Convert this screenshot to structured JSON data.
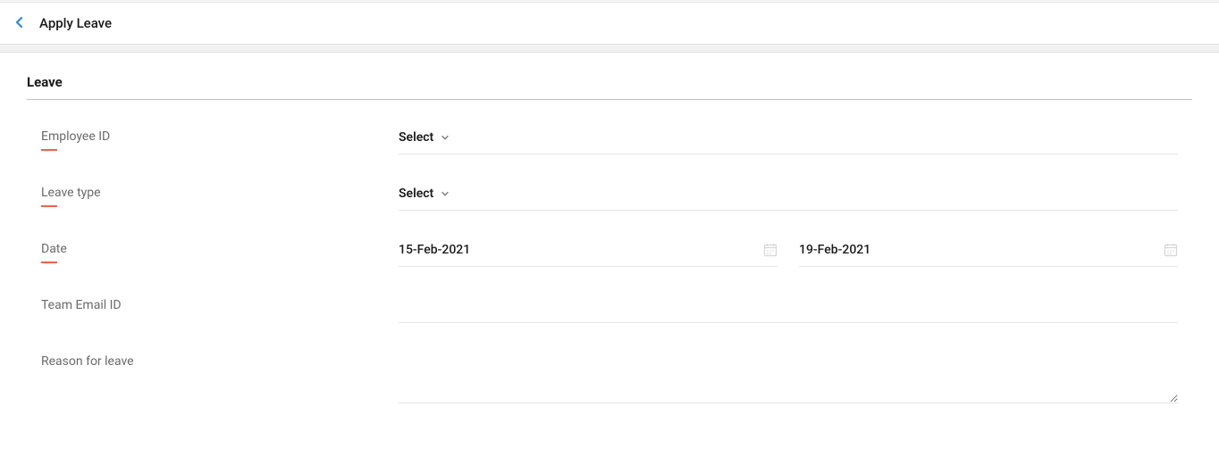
{
  "header": {
    "title": "Apply Leave"
  },
  "section": {
    "title": "Leave"
  },
  "fields": {
    "employee_id": {
      "label": "Employee ID",
      "placeholder": "Select"
    },
    "leave_type": {
      "label": "Leave type",
      "placeholder": "Select"
    },
    "date": {
      "label": "Date",
      "from": "15-Feb-2021",
      "to": "19-Feb-2021"
    },
    "team_email": {
      "label": "Team Email ID",
      "value": ""
    },
    "reason": {
      "label": "Reason for leave",
      "value": ""
    }
  }
}
